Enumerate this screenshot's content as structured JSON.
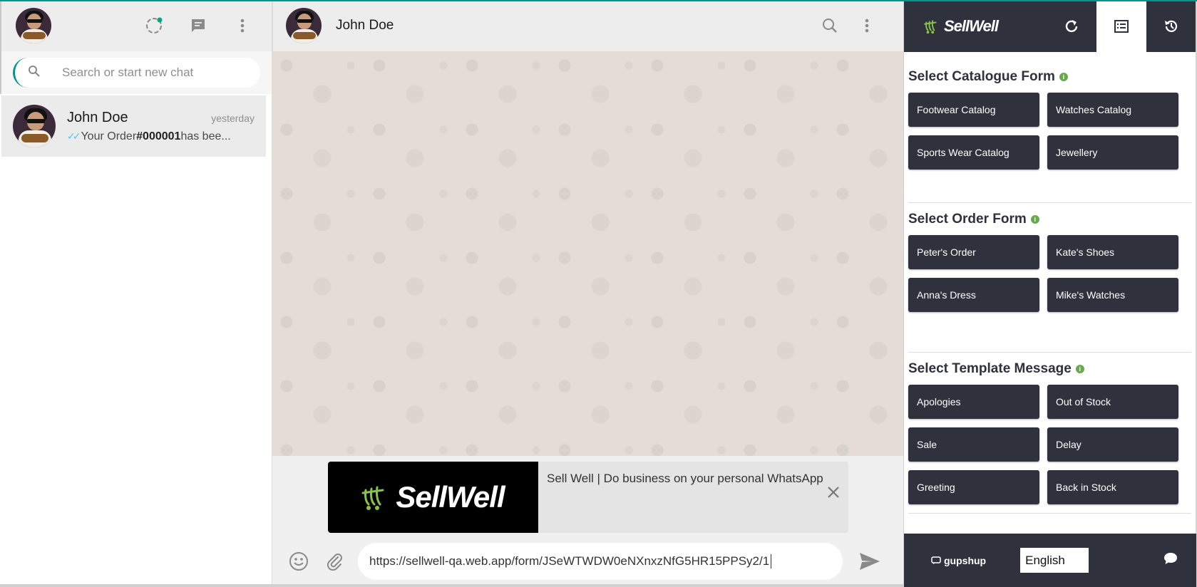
{
  "left_panel": {
    "search": {
      "placeholder": "Search or start new chat"
    },
    "chats": [
      {
        "name": "John Doe",
        "time": "yesterday",
        "preview_prefix": "Your Order ",
        "preview_bold": "#000001",
        "preview_suffix": " has bee..."
      }
    ]
  },
  "conversation": {
    "contact_name": "John Doe",
    "link_preview": {
      "image_logo": "SellWell",
      "title": "Sell Well | Do business on your personal WhatsApp"
    },
    "message_input": "https://sellwell-qa.web.app/form/JSeWTWDW0eNXnxzNfG5HR15PPSy2/1"
  },
  "sellwell_panel": {
    "brand": "SellWell",
    "sections": [
      {
        "title": "Select Catalogue Form",
        "buttons": [
          "Footwear Catalog",
          "Watches Catalog",
          "Sports Wear Catalog",
          "Jewellery"
        ]
      },
      {
        "title": "Select Order Form",
        "buttons": [
          "Peter's Order",
          "Kate's Shoes",
          "Anna's Dress",
          "Mike's Watches"
        ]
      },
      {
        "title": "Select Template Message",
        "buttons": [
          "Apologies",
          "Out of Stock",
          "Sale",
          "Delay",
          "Greeting",
          "Back in Stock"
        ]
      }
    ],
    "footer": {
      "provider": "gupshup",
      "language": "English"
    }
  },
  "colors": {
    "brand_dark": "#2f323d",
    "accent_green": "#8bc34a",
    "wallpaper": "#e5ddd5",
    "teal": "#009688",
    "tick_blue": "#4fc3f7"
  },
  "icons": {
    "left_header": [
      "status-icon",
      "new-chat-icon",
      "menu-dots-icon"
    ],
    "mid_header": [
      "search-icon",
      "menu-dots-icon"
    ],
    "composer": [
      "emoji-icon",
      "attach-icon",
      "send-icon",
      "close-icon"
    ],
    "right_header": [
      "refresh-icon",
      "list-icon",
      "history-icon"
    ]
  }
}
